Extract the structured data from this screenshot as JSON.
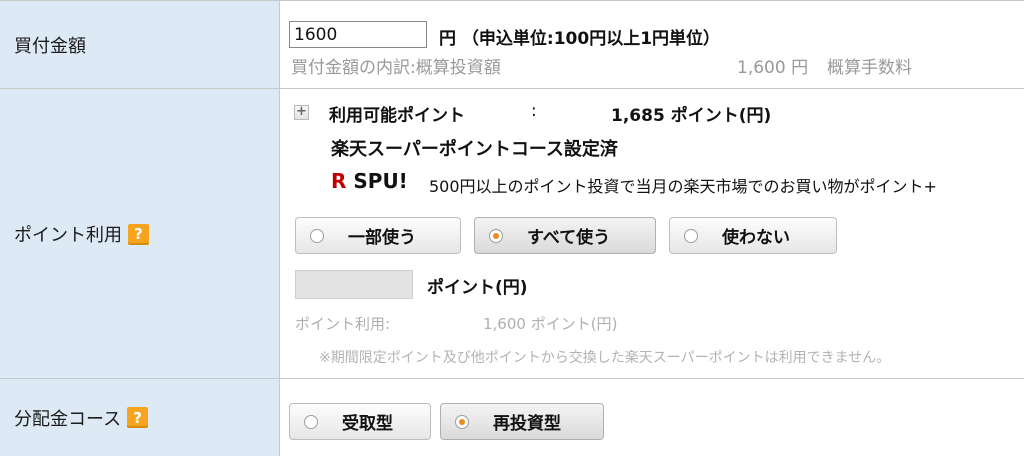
{
  "amount_row": {
    "label": "買付金額",
    "input_value": "1600",
    "unit_text": "円 （申込単位:100円以上1円単位）",
    "breakdown_label": "買付金額の内訳:概算投資額",
    "breakdown_value": "1,600 円",
    "fee_label": "概算手数料"
  },
  "point_row": {
    "label": "ポイント利用",
    "help_icon": "?",
    "available_label": "利用可能ポイント",
    "colon": ":",
    "available_value": "1,685 ポイント(円)",
    "course_status": "楽天スーパーポイントコース設定済",
    "spu_logo_r": "R",
    "spu_logo_text": "SPU!",
    "spu_text": "500円以上のポイント投資で当月の楽天市場でのお買い物がポイント+",
    "options": [
      {
        "label": "一部使う",
        "selected": false
      },
      {
        "label": "すべて使う",
        "selected": true
      },
      {
        "label": "使わない",
        "selected": false
      }
    ],
    "point_input_value": "",
    "point_unit": "ポイント(円)",
    "usage_label": "ポイント利用:",
    "usage_value": "1,600 ポイント(円)",
    "note": "※期間限定ポイント及び他ポイントから交換した楽天スーパーポイントは利用できません。"
  },
  "course_row": {
    "label": "分配金コース",
    "help_icon": "?",
    "options": [
      {
        "label": "受取型",
        "selected": false
      },
      {
        "label": "再投資型",
        "selected": true
      }
    ]
  },
  "colors": {
    "label_bg": "#ddeaf5",
    "help_icon": "#f6a41d",
    "radio_selected": "#f08a1d",
    "spu_red": "#bf0000"
  }
}
